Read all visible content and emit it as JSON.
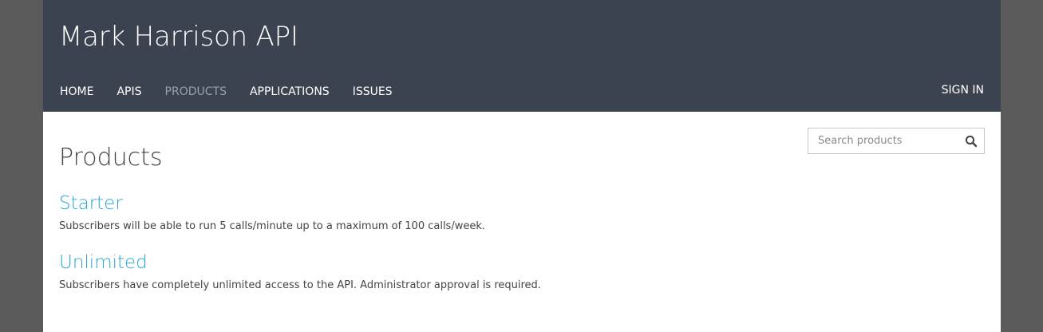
{
  "header": {
    "title": "Mark Harrison API",
    "nav": [
      {
        "label": "HOME",
        "active": false
      },
      {
        "label": "APIS",
        "active": false
      },
      {
        "label": "PRODUCTS",
        "active": true
      },
      {
        "label": "APPLICATIONS",
        "active": false
      },
      {
        "label": "ISSUES",
        "active": false
      }
    ],
    "signin_label": "SIGN IN"
  },
  "search": {
    "placeholder": "Search products",
    "value": "",
    "icon": "search-icon"
  },
  "main": {
    "title": "Products",
    "products": [
      {
        "name": "Starter",
        "description": "Subscribers will be able to run 5 calls/minute up to a maximum of 100 calls/week."
      },
      {
        "name": "Unlimited",
        "description": "Subscribers have completely unlimited access to the API. Administrator approval is required."
      }
    ]
  },
  "colors": {
    "header_bg": "#3c4350",
    "link": "#2aa6d6",
    "active_nav": "#98a0aa",
    "outer_bg": "#5a5a5a"
  }
}
